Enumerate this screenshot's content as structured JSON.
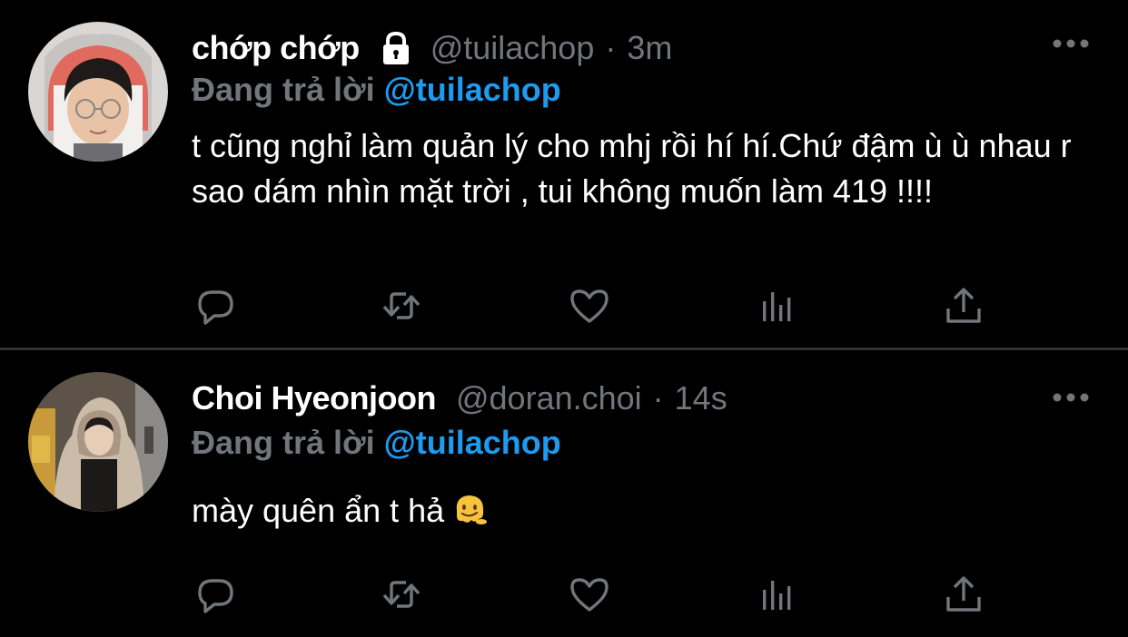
{
  "colors": {
    "background": "#000000",
    "text": "#ffffff",
    "muted": "#71767b",
    "accent": "#1d9bf0",
    "divider": "#2f3336"
  },
  "tweets": [
    {
      "display_name": "chớp chớp",
      "protected": true,
      "handle": "@tuilachop",
      "separator": "·",
      "time": "3m",
      "reply_prefix": "Đang trả lời",
      "reply_to": "@tuilachop",
      "text": "t cũng nghỉ làm quản lý cho mhj rồi hí hí.Chứ đậm ù ù nhau r sao dám nhìn mặt trời , tui không muốn làm 419 !!!!",
      "icons": [
        "lock-icon",
        "more-icon",
        "reply-icon",
        "retweet-icon",
        "like-icon",
        "stats-icon",
        "share-icon"
      ]
    },
    {
      "display_name": "Choi Hyeonjoon",
      "protected": false,
      "handle": "@doran.choi",
      "separator": "·",
      "time": "14s",
      "reply_prefix": "Đang trả lời",
      "reply_to": "@tuilachop",
      "text": "mày quên ẩn t hả",
      "emoji": "melting-face-emoji",
      "icons": [
        "more-icon",
        "reply-icon",
        "retweet-icon",
        "like-icon",
        "stats-icon",
        "share-icon"
      ]
    }
  ]
}
